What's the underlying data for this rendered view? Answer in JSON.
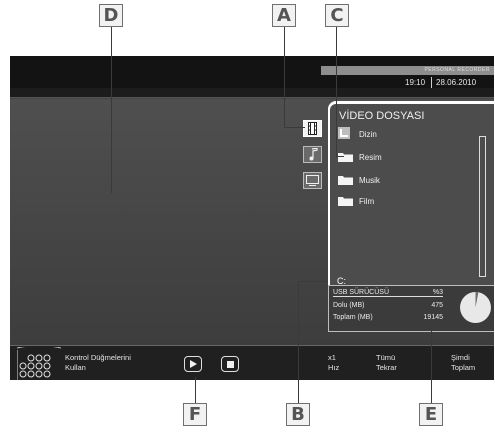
{
  "callouts": {
    "A": "A",
    "B": "B",
    "C": "C",
    "D": "D",
    "E": "E",
    "F": "F"
  },
  "header": {
    "recorder_label": "PERSONAL RECORDER",
    "time": "19:10",
    "date": "28.06.2010"
  },
  "media_tabs": [
    {
      "icon": "film-icon",
      "selected": true
    },
    {
      "icon": "music-note-icon",
      "selected": false
    },
    {
      "icon": "picture-icon",
      "selected": false
    }
  ],
  "panel": {
    "title": "VİDEO DOSYASI",
    "items": [
      {
        "label": "Dizin",
        "icon": "up-folder-icon"
      },
      {
        "label": "Resim",
        "icon": "folder-icon"
      },
      {
        "label": "Musik",
        "icon": "folder-icon"
      },
      {
        "label": "Film",
        "icon": "folder-icon"
      }
    ],
    "drive": "C:"
  },
  "storage": {
    "name": "USB SÜRÜCÜSÜ",
    "percent": "%3",
    "used_label": "Dolu (MB)",
    "used_value": "475",
    "total_label": "Toplam (MB)",
    "total_value": "19145",
    "used_fraction": 0.03
  },
  "footer": {
    "hint_line1": "Kontrol Düğmelerini",
    "hint_line2": "Kullan",
    "speed_value": "x1",
    "speed_label": "Hız",
    "repeat_value": "Tümü",
    "repeat_label": "Tekrar",
    "time_value": "Şimdi",
    "time_label": "Toplam"
  },
  "colors": {
    "background": "#444444",
    "panel": "#4c4c4c",
    "accent": "#ffffff"
  }
}
